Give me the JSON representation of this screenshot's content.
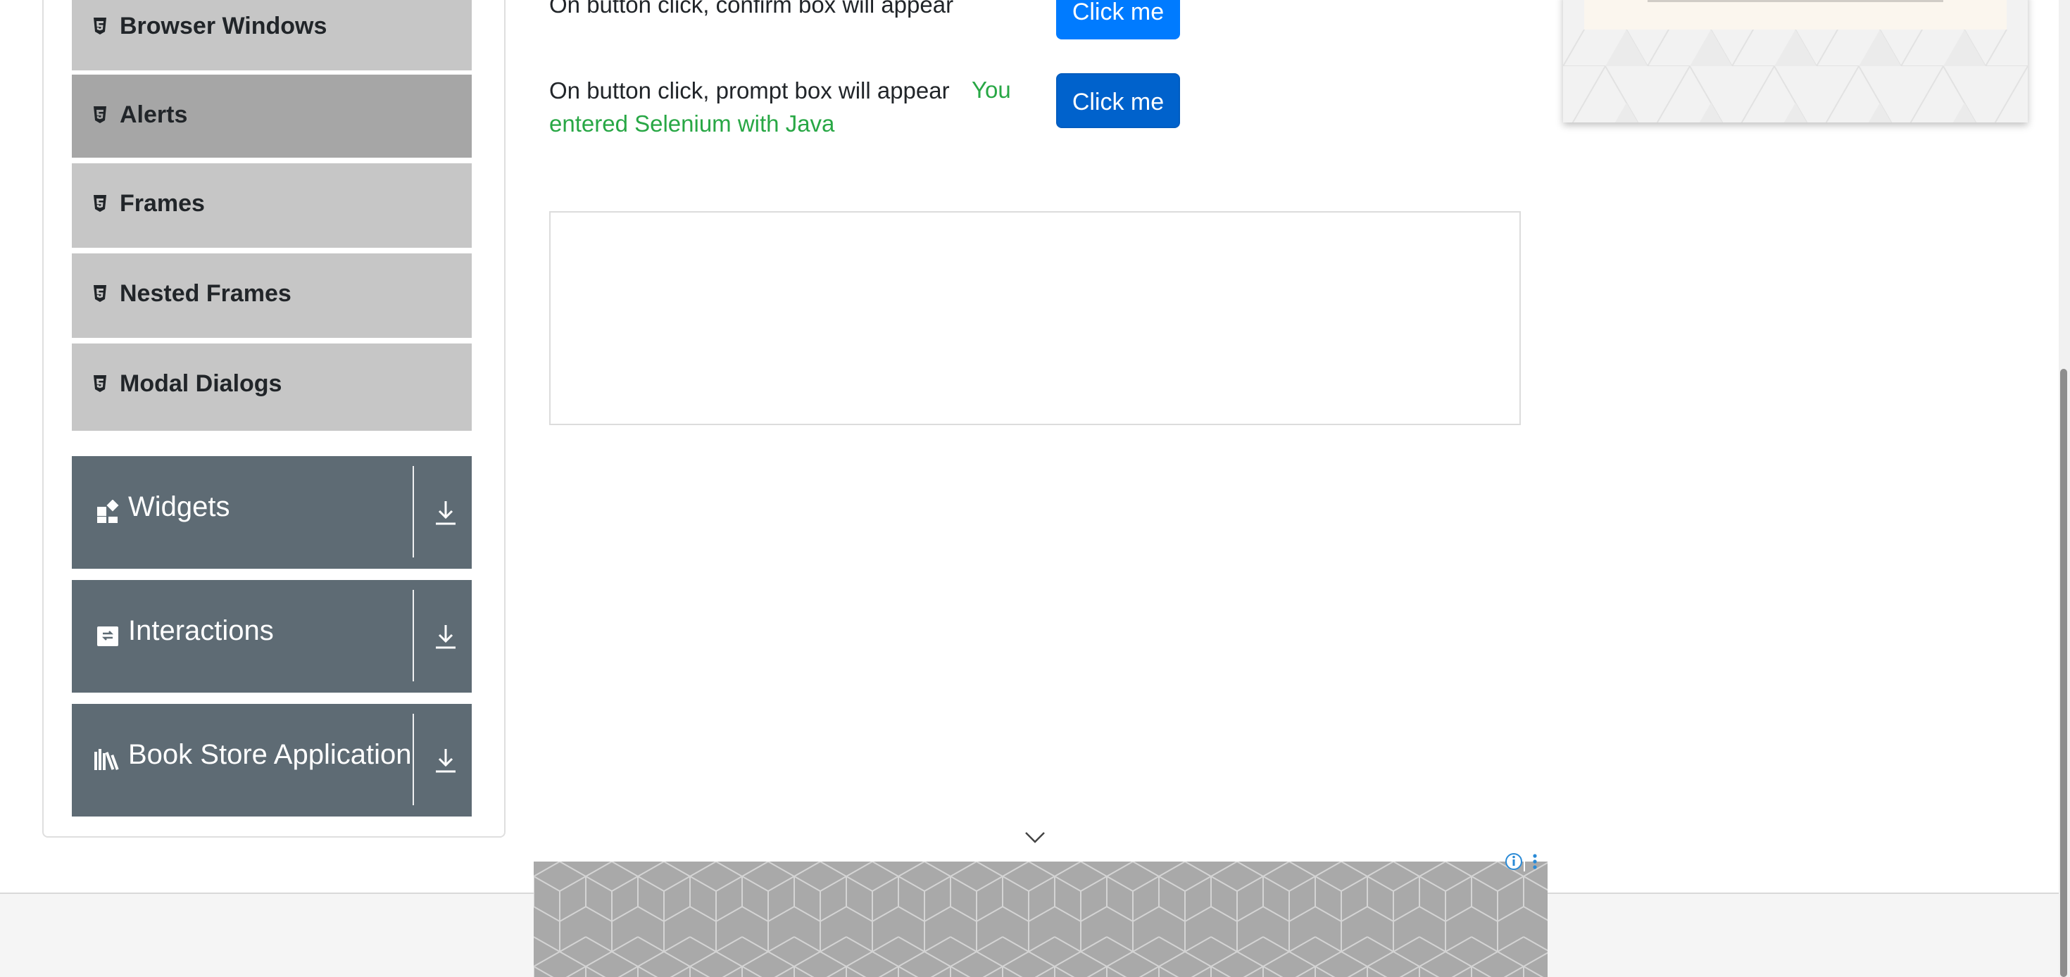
{
  "sidebar": {
    "alerts_items": [
      {
        "label": "Browser Windows",
        "icon": "html5-icon"
      },
      {
        "label": "Alerts",
        "icon": "html5-icon",
        "active": true
      },
      {
        "label": "Frames",
        "icon": "html5-icon"
      },
      {
        "label": "Nested Frames",
        "icon": "html5-icon"
      },
      {
        "label": "Modal Dialogs",
        "icon": "html5-icon"
      }
    ],
    "groups": [
      {
        "label": "Widgets",
        "icon": "widgets-icon"
      },
      {
        "label": "Interactions",
        "icon": "interactions-icon"
      },
      {
        "label": "Book Store Application",
        "icon": "books-icon"
      }
    ]
  },
  "main": {
    "confirm_row": {
      "text": "On button click, confirm box will appear",
      "button": "Click me"
    },
    "prompt_row": {
      "text": "On button click, prompt box will appear",
      "result": "You entered Selenium with Java",
      "button": "Click me"
    }
  },
  "colors": {
    "primary": "#007bff",
    "success": "#28a745",
    "sidebar_group": "#5e6b74",
    "sidebar_item": "#c6c6c6",
    "sidebar_active": "#a6a6a6"
  }
}
